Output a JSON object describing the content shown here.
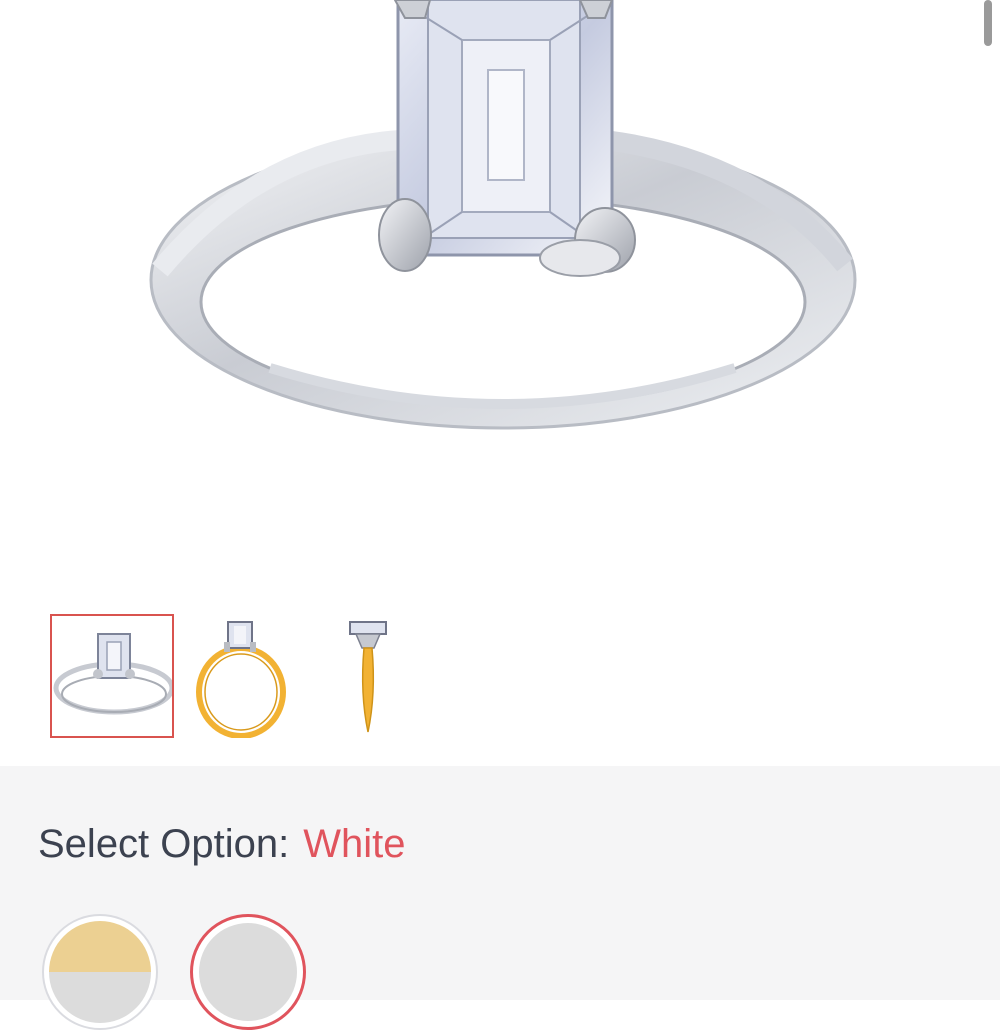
{
  "product": {
    "images": [
      {
        "name": "white-gold-front",
        "metal": "white"
      },
      {
        "name": "yellow-gold-front",
        "metal": "yellow"
      },
      {
        "name": "yellow-gold-side",
        "metal": "yellow"
      }
    ],
    "selected_image_index": 0
  },
  "option": {
    "label": "Select Option:",
    "selected": "White",
    "swatches": [
      {
        "name": "Yellow",
        "top_color": "#ecd092",
        "bottom_color": "#dcdcdc"
      },
      {
        "name": "White",
        "top_color": "#dcdcdc",
        "bottom_color": "#dcdcdc"
      }
    ],
    "selected_swatch_index": 1
  },
  "colors": {
    "accent": "#e0545d",
    "label_text": "#3c4250",
    "panel_bg": "#f5f5f6",
    "gold": "#f2b233",
    "metal": "#d6d8de"
  }
}
